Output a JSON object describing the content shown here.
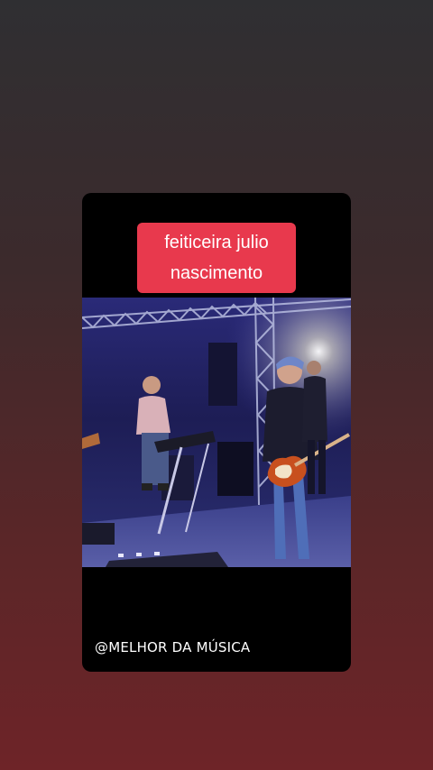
{
  "story": {
    "caption_line1": "feiticeira julio",
    "caption_line2": "nascimento",
    "caption_color": "#e8394d",
    "watermark": "@MELHOR DA MÚSICA"
  }
}
